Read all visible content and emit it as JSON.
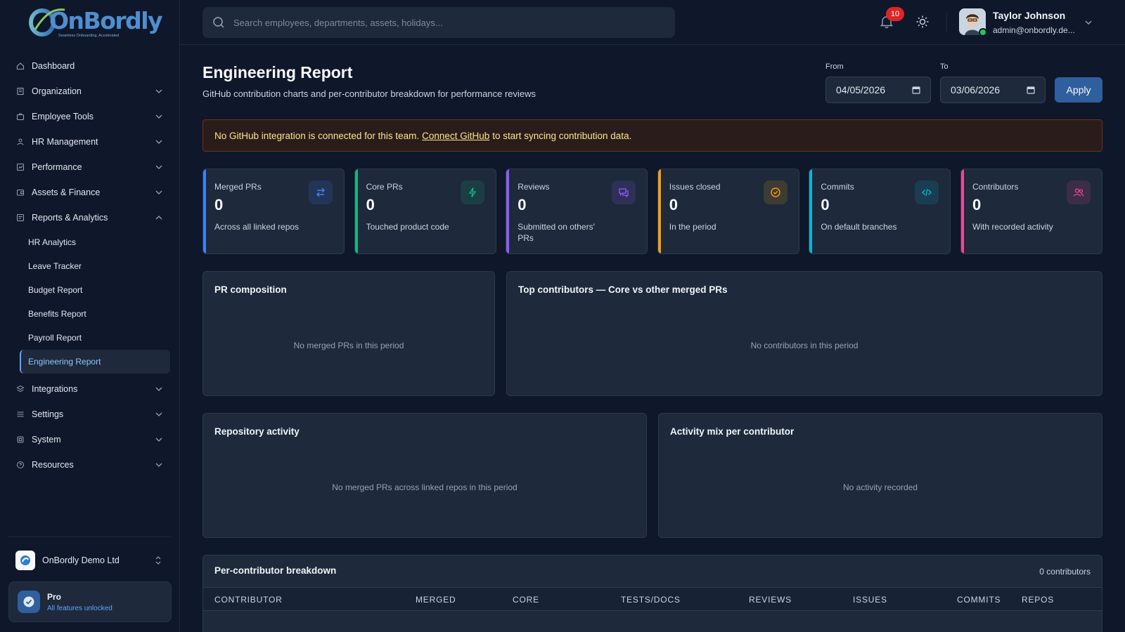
{
  "brand": {
    "logo_text": "OnBordly",
    "tagline": "Seamless Onboarding, Accelerated"
  },
  "sidebar": {
    "items": [
      {
        "label": "Dashboard",
        "icon": "home-icon",
        "expandable": false
      },
      {
        "label": "Organization",
        "icon": "building-icon",
        "expandable": true
      },
      {
        "label": "Employee Tools",
        "icon": "briefcase-icon",
        "expandable": true
      },
      {
        "label": "HR Management",
        "icon": "people-gear-icon",
        "expandable": true
      },
      {
        "label": "Performance",
        "icon": "chart-icon",
        "expandable": true
      },
      {
        "label": "Assets & Finance",
        "icon": "wallet-icon",
        "expandable": true
      },
      {
        "label": "Reports & Analytics",
        "icon": "report-icon",
        "expandable": true,
        "expanded": true
      }
    ],
    "sub_items": [
      "HR Analytics",
      "Leave Tracker",
      "Budget Report",
      "Benefits Report",
      "Payroll Report",
      "Engineering Report"
    ],
    "active_sub": "Engineering Report",
    "lower_items": [
      {
        "label": "Integrations",
        "icon": "layers-icon"
      },
      {
        "label": "Settings",
        "icon": "sliders-icon"
      },
      {
        "label": "System",
        "icon": "cpu-icon"
      },
      {
        "label": "Resources",
        "icon": "help-icon"
      }
    ],
    "org_name": "OnBordly Demo Ltd",
    "plan": {
      "title": "Pro",
      "subtitle": "All features unlocked"
    }
  },
  "topbar": {
    "search_placeholder": "Search employees, departments, assets, holidays...",
    "notifications_count": "10",
    "user": {
      "name": "Taylor Johnson",
      "email": "admin@onbordly.de..."
    }
  },
  "page": {
    "title": "Engineering Report",
    "subtitle": "GitHub contribution charts and per-contributor breakdown for performance reviews",
    "from_label": "From",
    "from_value": "04/05/2026",
    "to_label": "To",
    "to_value": "03/06/2026",
    "apply_label": "Apply"
  },
  "alert": {
    "before": "No GitHub integration is connected for this team.",
    "link": "Connect GitHub",
    "after": "to start syncing contribution data."
  },
  "stats": [
    {
      "label": "Merged PRs",
      "value": "0",
      "desc": "Across all linked repos",
      "color": "#3b82f6",
      "icon": "swap-arrows-icon"
    },
    {
      "label": "Core PRs",
      "value": "0",
      "desc": "Touched product code",
      "color": "#10b981",
      "icon": "lightning-icon"
    },
    {
      "label": "Reviews",
      "value": "0",
      "desc": "Submitted on others' PRs",
      "color": "#8b5cf6",
      "icon": "chat-bubbles-icon"
    },
    {
      "label": "Issues closed",
      "value": "0",
      "desc": "In the period",
      "color": "#f59e0b",
      "icon": "check-circle-icon"
    },
    {
      "label": "Commits",
      "value": "0",
      "desc": "On default branches",
      "color": "#06b6d4",
      "icon": "code-icon"
    },
    {
      "label": "Contributors",
      "value": "0",
      "desc": "With recorded activity",
      "color": "#ec4899",
      "icon": "users-icon"
    }
  ],
  "panels": {
    "pr_composition": {
      "title": "PR composition",
      "empty": "No merged PRs in this period"
    },
    "top_contributors": {
      "title": "Top contributors — Core vs other merged PRs",
      "empty": "No contributors in this period"
    },
    "repo_activity": {
      "title": "Repository activity",
      "empty": "No merged PRs across linked repos in this period"
    },
    "activity_mix": {
      "title": "Activity mix per contributor",
      "empty": "No activity recorded"
    }
  },
  "table": {
    "title": "Per-contributor breakdown",
    "count": "0 contributors",
    "columns": [
      "CONTRIBUTOR",
      "MERGED",
      "CORE",
      "TESTS/DOCS",
      "REVIEWS",
      "ISSUES",
      "COMMITS",
      "REPOS"
    ]
  }
}
